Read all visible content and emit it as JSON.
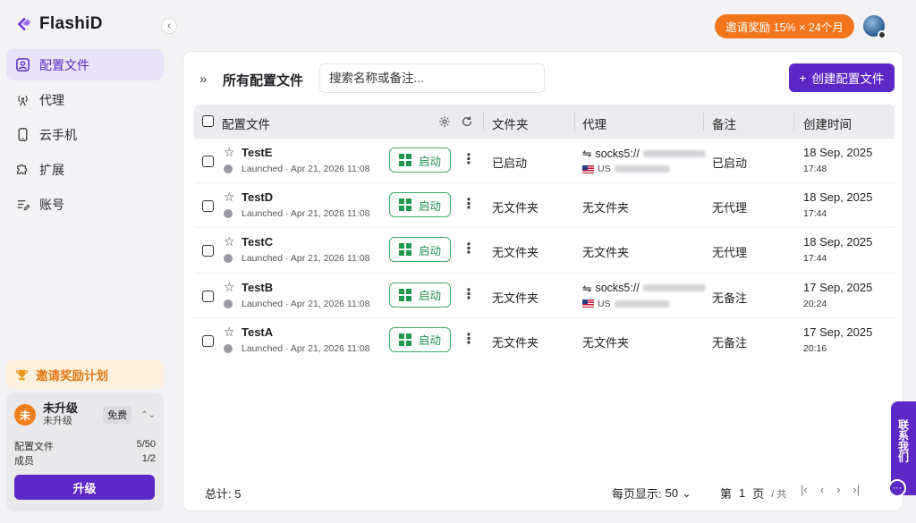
{
  "app": {
    "logo_text": "FlashiD"
  },
  "sidebar": {
    "items": [
      {
        "label": "配置文件",
        "icon": "profile-icon"
      },
      {
        "label": "代理",
        "icon": "antenna-icon"
      },
      {
        "label": "云手机",
        "icon": "phone-icon"
      },
      {
        "label": "扩展",
        "icon": "puzzle-icon"
      },
      {
        "label": "账号",
        "icon": "account-icon"
      }
    ],
    "invite_plan": "邀请奖励计划",
    "plan": {
      "avatar_letter": "未",
      "name": "未升级",
      "sub": "未升级",
      "badge": "免费",
      "profiles_label": "配置文件",
      "profiles_value": "5/50",
      "members_label": "成员",
      "members_value": "1/2",
      "upgrade_label": "升级"
    }
  },
  "header": {
    "invite_pill": "邀请奖励 15% × 24个月"
  },
  "toolbar": {
    "title": "所有配置文件",
    "search_placeholder": "搜索名称或备注...",
    "create_label": "创建配置文件"
  },
  "table": {
    "columns": {
      "profile": "配置文件",
      "folder": "文件夹",
      "proxy": "代理",
      "note": "备注",
      "created": "创建时间"
    },
    "rows": [
      {
        "name": "TestE",
        "launched": "Launched · Apr 21, 2026 11:08",
        "start": "启动",
        "folder": "已启动",
        "proxy": {
          "type": "socks5://",
          "country": "US"
        },
        "note": "已启动",
        "date": "18 Sep, 2025",
        "time": "17:48"
      },
      {
        "name": "TestD",
        "launched": "Launched · Apr 21, 2026 11:08",
        "start": "启动",
        "folder": "无文件夹",
        "proxy_text": "无文件夹",
        "note": "无代理",
        "date": "18 Sep, 2025",
        "time": "17:44"
      },
      {
        "name": "TestC",
        "launched": "Launched · Apr 21, 2026 11:08",
        "start": "启动",
        "folder": "无文件夹",
        "proxy_text": "无文件夹",
        "note": "无代理",
        "date": "18 Sep, 2025",
        "time": "17:44"
      },
      {
        "name": "TestB",
        "launched": "Launched · Apr 21, 2026 11:08",
        "start": "启动",
        "folder": "无文件夹",
        "proxy": {
          "type": "socks5://",
          "country": "US"
        },
        "note": "无备注",
        "date": "17 Sep, 2025",
        "time": "20:24"
      },
      {
        "name": "TestA",
        "launched": "Launched · Apr 21, 2026 11:08",
        "start": "启动",
        "folder": "无文件夹",
        "proxy_text": "无文件夹",
        "note": "无备注",
        "date": "17 Sep, 2025",
        "time": "20:16"
      }
    ]
  },
  "footer": {
    "total": "总计: 5",
    "per_page_label": "每页显示:",
    "per_page_value": "50",
    "page_prefix": "第",
    "page_number": "1",
    "page_suffix": "页",
    "page_total": "/ 共"
  },
  "contact": {
    "label": "联系我们"
  },
  "colors": {
    "brand": "#5b27c5",
    "accent_orange": "#f2751b",
    "start_green": "#1e8f4d"
  }
}
